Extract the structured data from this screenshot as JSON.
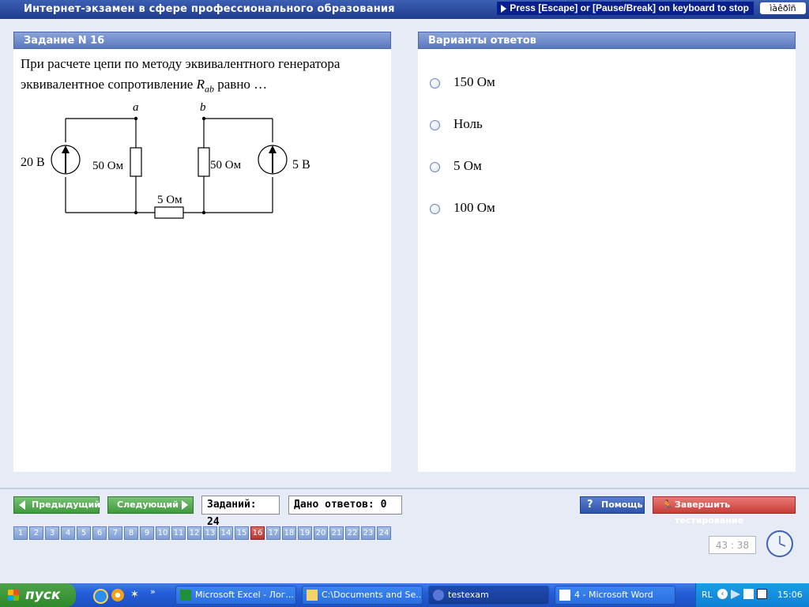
{
  "app": {
    "title": "Интернет-экзамен в сфере профессионального образования",
    "escape_hint": "Press [Escape] or [Pause/Break] on keyboard to stop",
    "lang_indicator": "ìàêðîñ"
  },
  "question": {
    "header": "Задание N 16",
    "text_line1": "При расчете цепи по методу эквивалентного генератора",
    "text_line2_prefix": "эквивалентное сопротивление ",
    "var_R": "R",
    "var_sub": "ab",
    "text_line2_suffix": " равно …",
    "circuit": {
      "node_a": "a",
      "node_b": "b",
      "src_left": "20 В",
      "res_left": "50 Ом",
      "res_bottom": "5 Ом",
      "res_right": "50 Ом",
      "src_right": "5 В"
    }
  },
  "answers": {
    "header": "Варианты ответов",
    "options": [
      {
        "label": "150 Ом"
      },
      {
        "label": "Ноль"
      },
      {
        "label": "5 Ом"
      },
      {
        "label": "100 Ом"
      }
    ]
  },
  "nav": {
    "prev_label": "Предыдущий",
    "next_label": "Следующий",
    "tasks_count": "Заданий: 24",
    "answers_given": "Дано ответов: 0",
    "help_label": "Помощь",
    "finish_label": "Завершить тестирование",
    "pages": [
      "1",
      "2",
      "3",
      "4",
      "5",
      "6",
      "7",
      "8",
      "9",
      "10",
      "11",
      "12",
      "13",
      "14",
      "15",
      "16",
      "17",
      "18",
      "19",
      "20",
      "21",
      "22",
      "23",
      "24"
    ],
    "current_page": "16",
    "timer": "43 : 38"
  },
  "taskbar": {
    "start_label": "пуск",
    "tasks": [
      {
        "label": "Microsoft Excel - Лог...",
        "icon": "excel-icon"
      },
      {
        "label": "C:\\Documents and Se...",
        "icon": "folder-icon"
      },
      {
        "label": "testexam",
        "icon": "app-icon"
      },
      {
        "label": "4 - Microsoft Word",
        "icon": "word-icon"
      }
    ],
    "lang": "RL",
    "clock": "15:06"
  }
}
